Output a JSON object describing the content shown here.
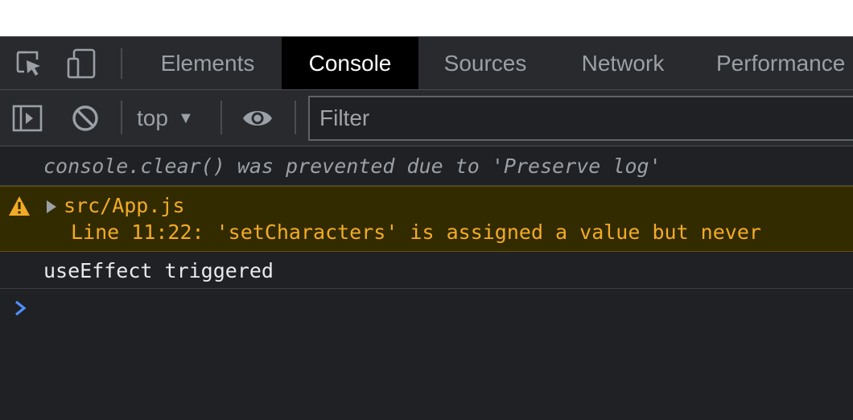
{
  "tabs": [
    {
      "label": "Elements",
      "active": false
    },
    {
      "label": "Console",
      "active": true
    },
    {
      "label": "Sources",
      "active": false
    },
    {
      "label": "Network",
      "active": false
    },
    {
      "label": "Performance",
      "active": false
    }
  ],
  "toolbar": {
    "context": "top",
    "filter_placeholder": "Filter"
  },
  "console": {
    "messages": [
      {
        "level": "info",
        "text": "console.clear() was prevented due to 'Preserve log'"
      },
      {
        "level": "warning",
        "source": "src/App.js",
        "detail": "Line 11:22:  'setCharacters' is assigned a value but never"
      },
      {
        "level": "log",
        "text": "useEffect triggered"
      }
    ]
  },
  "icons": {
    "inspect": "inspect-element-icon",
    "device": "device-toolbar-icon",
    "sidebar": "show-sidebar-icon",
    "clear": "clear-console-icon",
    "eye": "live-expression-icon",
    "warning": "warning-icon",
    "prompt": "console-prompt-icon"
  },
  "colors": {
    "panel_bg": "#202124",
    "toolbar_bg": "#292a2d",
    "warning_bg": "#332b00",
    "warning_text": "#f2ab26",
    "prompt_blue": "#4d90fe"
  }
}
